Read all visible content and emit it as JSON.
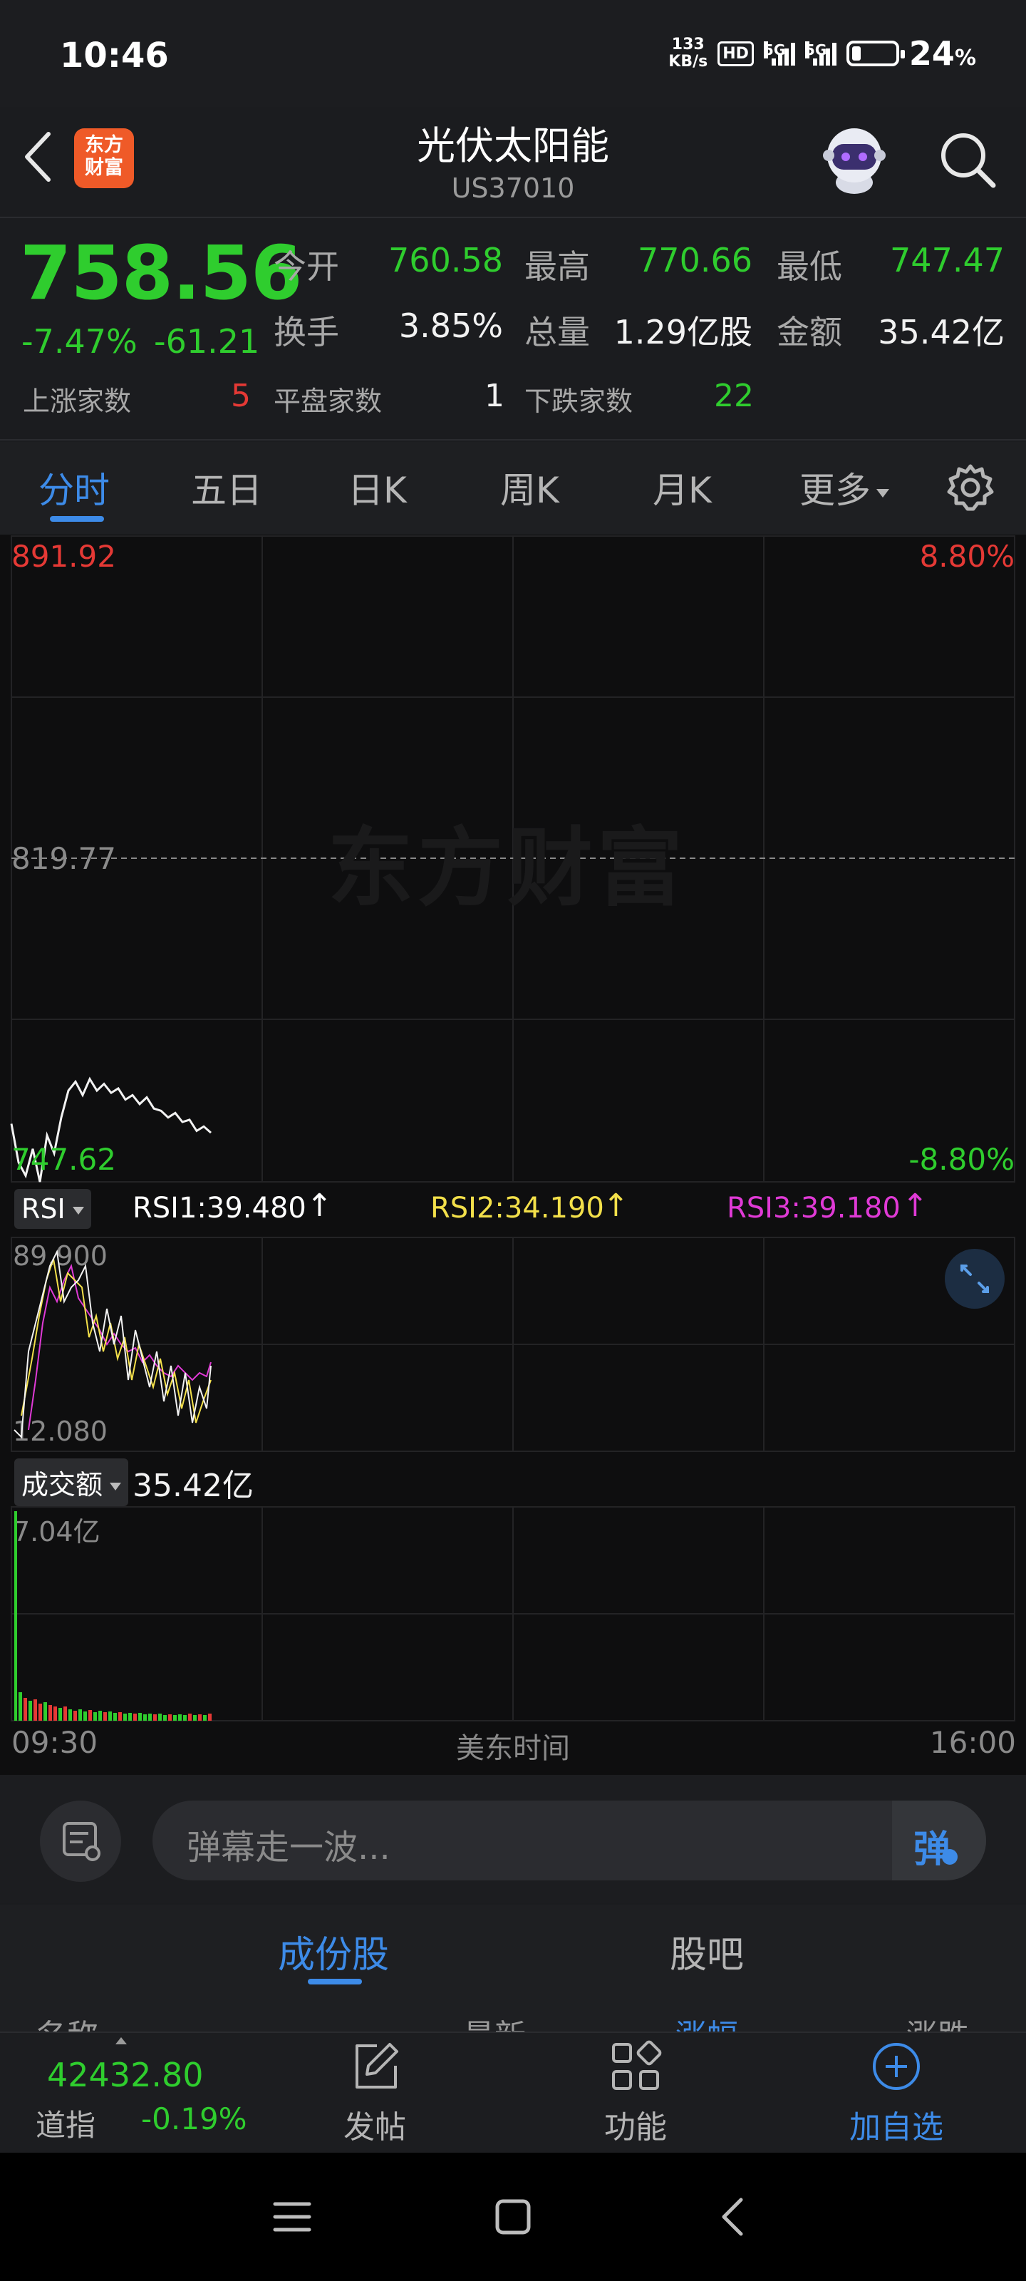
{
  "status_bar": {
    "time": "10:46",
    "net_speed_value": "133",
    "net_speed_unit": "KB/s",
    "hd_badge": "HD",
    "sig1_label": "5G",
    "sig2_label": "5G",
    "battery": "24",
    "battery_unit": "%"
  },
  "header": {
    "logo_line1": "东方",
    "logo_line2": "财富",
    "title": "光伏太阳能",
    "code": "US37010"
  },
  "quote": {
    "price": "758.56",
    "change_pct": "-7.47%",
    "change": "-61.21",
    "open_label": "今开",
    "open": "760.58",
    "high_label": "最高",
    "high": "770.66",
    "low_label": "最低",
    "low": "747.47",
    "turnover_label": "换手",
    "turnover": "3.85%",
    "volume_label": "总量",
    "volume": "1.29亿股",
    "amount_label": "金额",
    "amount": "35.42亿",
    "up_label": "上涨家数",
    "up_count": "5",
    "flat_label": "平盘家数",
    "flat_count": "1",
    "down_label": "下跌家数",
    "down_count": "22"
  },
  "tabs": {
    "items": [
      "分时",
      "五日",
      "日K",
      "周K",
      "月K",
      "更多"
    ]
  },
  "chart": {
    "max_price": "891.92",
    "max_pct": "8.80%",
    "mid_price": "819.77",
    "min_price": "747.62",
    "min_pct": "-8.80%",
    "watermark": "东方财富",
    "rsi_tag": "RSI",
    "rsi1": "RSI1:39.480",
    "rsi2": "RSI2:34.190",
    "rsi3": "RSI3:39.180",
    "rsi_max": "89.900",
    "rsi_min": "12.080",
    "vol_tag": "成交额",
    "vol_total": "35.42亿",
    "vol_max": "7.04亿",
    "time_start": "09:30",
    "time_mid": "美东时间",
    "time_end": "16:00",
    "colors": {
      "rsi1": "#ffffff",
      "rsi2": "#f3e04a",
      "rsi3": "#e03ad6",
      "up": "#e53935",
      "down": "#2fcd2e"
    }
  },
  "chart_data": {
    "type": "line",
    "price_series": [
      760.6,
      752.0,
      749.0,
      755.0,
      747.6,
      758.0,
      754.0,
      762.0,
      768.0,
      770.0,
      767.0,
      770.6,
      768.0,
      769.5,
      767.5,
      768.5,
      766.0,
      767.0,
      765.0,
      766.5,
      764.0,
      763.5,
      762.0,
      763.0,
      761.0,
      761.5,
      759.0,
      760.0,
      758.6
    ],
    "ylim": [
      747.62,
      891.92
    ],
    "pre_close": 819.77,
    "x_range": [
      "09:30",
      "16:00"
    ]
  },
  "danmu": {
    "placeholder": "弹幕走一波...",
    "button": "弹"
  },
  "components": {
    "tab_active": "成份股",
    "tab_other": "股吧",
    "col_name": "名称",
    "col_latest": "最新",
    "col_pct": "涨幅",
    "col_change": "涨跌"
  },
  "bottom_bar": {
    "index_value": "42432.80",
    "index_name": "道指",
    "index_pct": "-0.19%",
    "post": "发帖",
    "functions": "功能",
    "add_watch": "加自选"
  }
}
